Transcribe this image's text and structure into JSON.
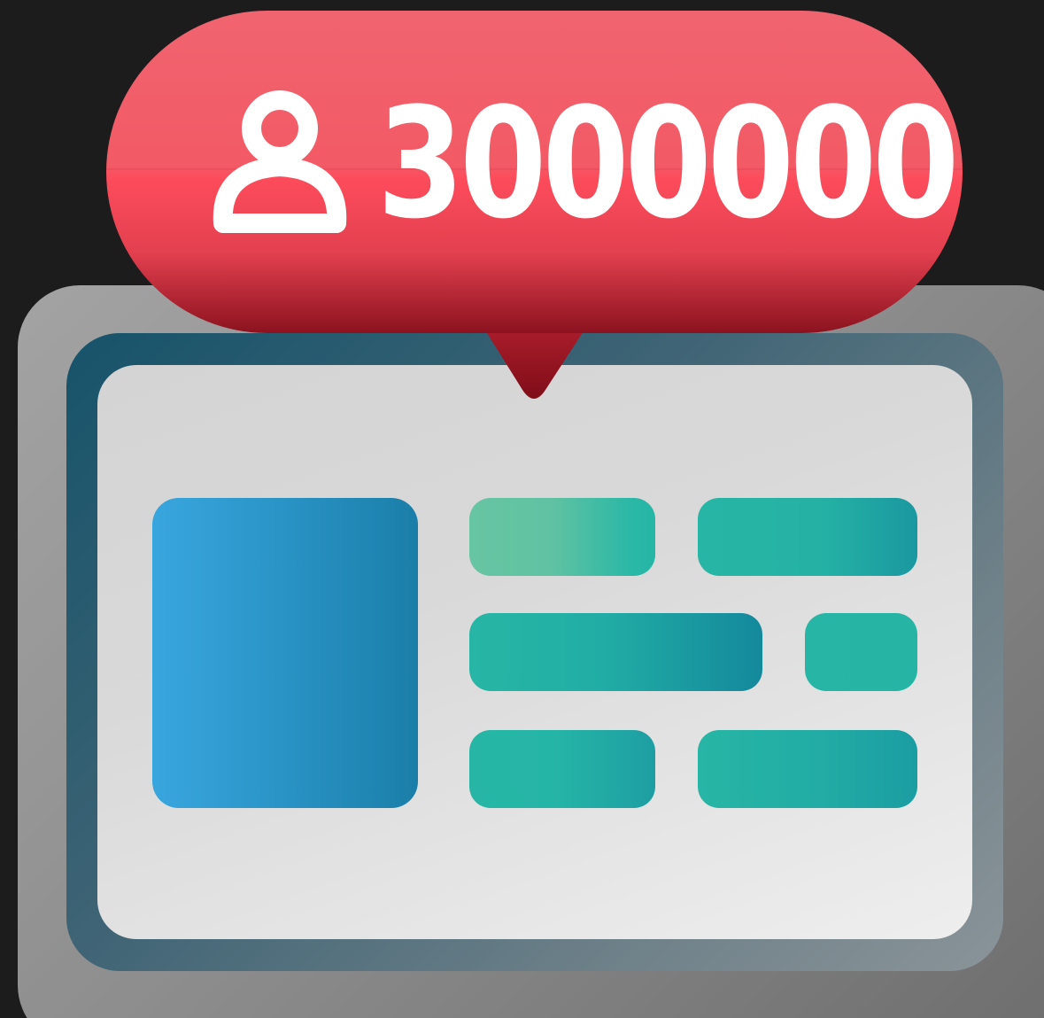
{
  "badge": {
    "icon": "user-icon",
    "count": "3000000",
    "color": "#f25a65"
  },
  "card": {
    "image_color": "#38a6de",
    "bar_color": "#27b6a5"
  }
}
